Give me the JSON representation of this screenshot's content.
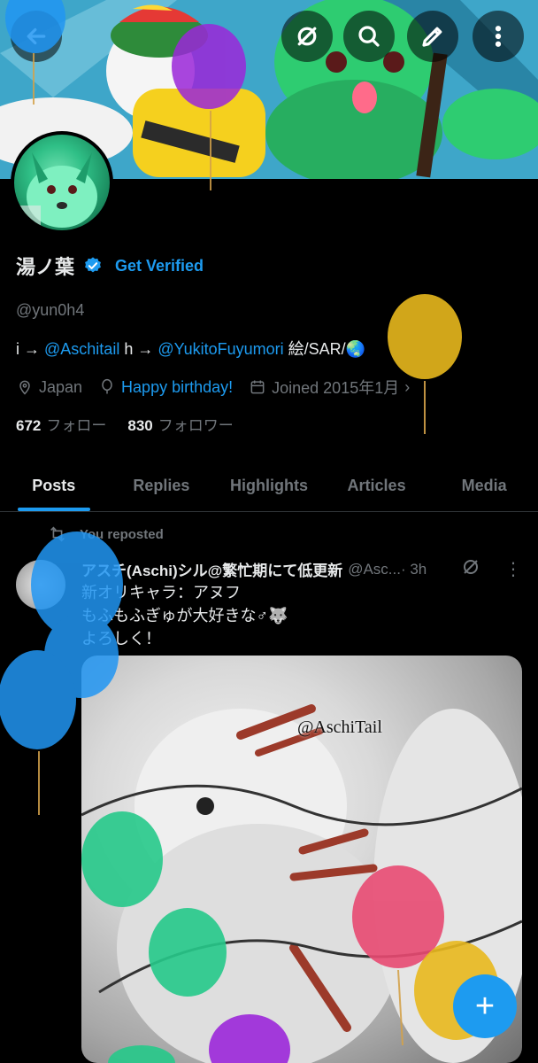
{
  "profile": {
    "name": "湯ノ葉",
    "get_verified": "Get Verified",
    "handle": "@yun0h4",
    "bio": {
      "prefix": "i → ",
      "link1": "@Aschitail",
      "mid": " h → ",
      "link2": "@YukitoFuyumori",
      "suffix": " 絵/SAR/🌏"
    },
    "location": "Japan",
    "birthday": "Happy birthday!",
    "joined": "Joined 2015年1月",
    "following_count": "672",
    "following_label": "フォロー",
    "followers_count": "830",
    "followers_label": "フォロワー"
  },
  "tabs": [
    "Posts",
    "Replies",
    "Highlights",
    "Articles",
    "Media"
  ],
  "post": {
    "repost_label": "You reposted",
    "author": "アスチ(Aschi)シル@繁忙期にて低更新",
    "handle": "@Asc...",
    "time": "· 3h",
    "text_line1": "新オリキャラ：アヌフ",
    "text_line2": "もふもふぎゅが大好きな♂🐺",
    "text_line3": "よろしく！",
    "image_watermark": "@AschiTail"
  },
  "icons": {
    "back": "back-arrow-icon",
    "grok": "grok-icon",
    "search": "search-icon",
    "edit": "edit-icon",
    "more": "more-vertical-icon"
  },
  "colors": {
    "accent": "#1d9bf0",
    "muted": "#71767b",
    "text": "#e7e9ea"
  }
}
